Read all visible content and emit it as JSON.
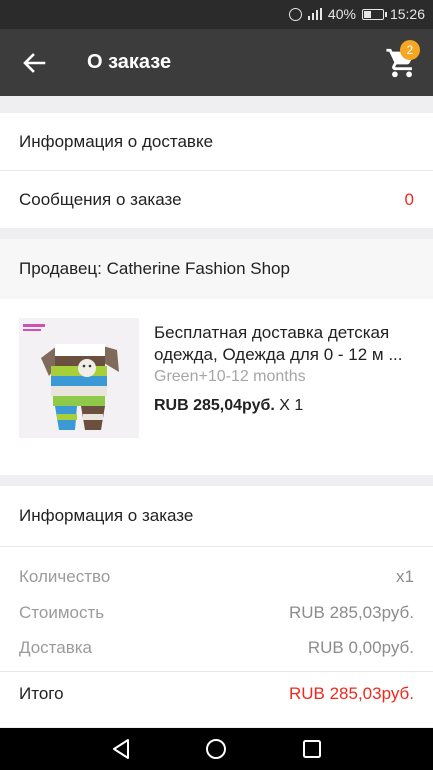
{
  "status_bar": {
    "battery": "40%",
    "time": "15:26",
    "battery_level": 0.4,
    "icons": [
      "alarm-icon",
      "signal-icon",
      "battery-icon"
    ]
  },
  "appbar": {
    "title": "О заказе",
    "cart_badge": "2",
    "icons": [
      "back-arrow-icon",
      "cart-icon"
    ]
  },
  "sections": {
    "delivery_info": "Информация о доставке",
    "order_messages": {
      "label": "Сообщения о заказе",
      "count": "0"
    }
  },
  "seller": {
    "label": "Продавец: Catherine Fashion Shop"
  },
  "product": {
    "title_line1": "Бесплатная доставка детская",
    "title_line2": "одежда, Одежда для 0 - 12 м ...",
    "variant": "Green+10-12 months",
    "price": "RUB 285,04руб.",
    "qty": "X 1"
  },
  "order_info": {
    "title": "Информация о заказе",
    "quantity": {
      "label": "Количество",
      "value": "x1"
    },
    "cost": {
      "label": "Стоимость",
      "value": "RUB 285,03руб."
    },
    "shipping": {
      "label": "Доставка",
      "value": "RUB 0,00руб."
    },
    "total": {
      "label": "Итого",
      "value": "RUB 285,03руб."
    }
  },
  "colors": {
    "accent_red": "#f0291f",
    "badge": "#f5a623",
    "appbar": "#3c3c3c"
  },
  "navbar": {
    "icons": [
      "back-triangle-icon",
      "home-circle-icon",
      "recents-square-icon"
    ]
  }
}
